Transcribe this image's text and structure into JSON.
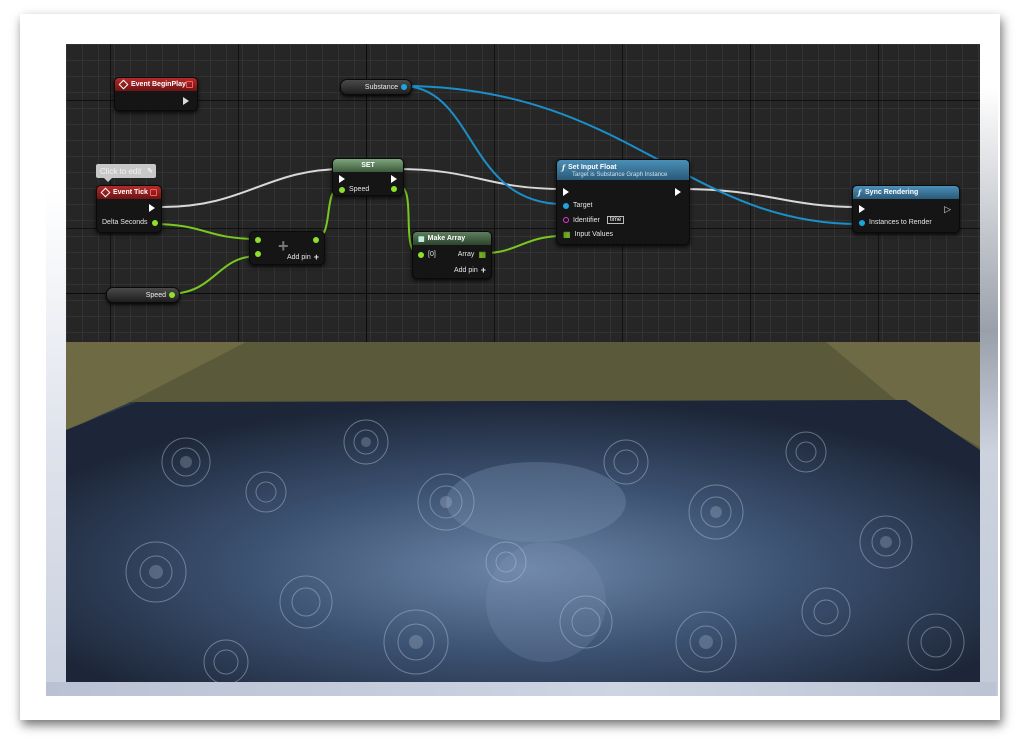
{
  "graph": {
    "tooltip": "Click to edit",
    "nodes": {
      "begin_play": {
        "title": "Event BeginPlay"
      },
      "event_tick": {
        "title": "Event Tick",
        "pin_delta": "Delta Seconds"
      },
      "speed_var": {
        "label": "Speed"
      },
      "substance_var": {
        "label": "Substance"
      },
      "add": {
        "add_pin": "Add pin"
      },
      "set": {
        "title": "SET",
        "pin_speed": "Speed"
      },
      "make_array": {
        "title": "Make Array",
        "pin_index": "[0]",
        "pin_array": "Array",
        "add_pin": "Add pin"
      },
      "set_input_float": {
        "title": "Set Input Float",
        "subtitle": "Target is Substance Graph Instance",
        "pin_target": "Target",
        "pin_identifier": "Identifier",
        "identifier_value": "time",
        "pin_input_values": "Input Values"
      },
      "sync_rendering": {
        "title": "Sync Rendering",
        "pin_instances": "Instances to Render"
      }
    },
    "colors": {
      "exec": "#ffffff",
      "float": "#8ee02b",
      "object": "#1fa3e0",
      "string": "#e23ad8",
      "event_header": "#b52a2a",
      "function_header": "#4b8fb8"
    }
  },
  "viewport": {
    "icon": "water-ripples-surface"
  }
}
